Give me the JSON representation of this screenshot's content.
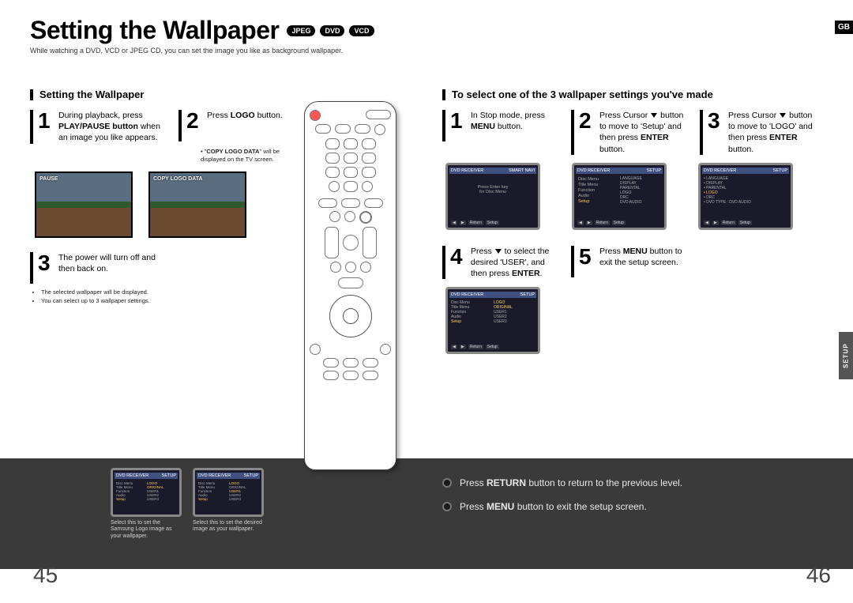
{
  "page": {
    "title": "Setting the Wallpaper",
    "subtitle": "While watching a DVD, VCD or JPEG CD, you can set the image you like as background wallpaper.",
    "badges": [
      "JPEG",
      "DVD",
      "VCD"
    ],
    "lang": "GB",
    "side_tab": "SETUP",
    "page_left": "45",
    "page_right": "46"
  },
  "left": {
    "heading": "Setting the Wallpaper",
    "step1_pre": "During playback, press ",
    "step1_bold": "PLAY/PAUSE button",
    "step1_post": " when an image you like appears.",
    "step2_pre": "Press ",
    "step2_bold": "LOGO",
    "step2_post": " button.",
    "note2_pre": "\"",
    "note2_bold": "COPY LOGO DATA",
    "note2_post": "\" will be displayed on the TV screen.",
    "photo1_overlay": "PAUSE",
    "photo2_overlay": "COPY LOGO DATA",
    "step3": "The power will turn off and then back on.",
    "note3a": "The selected wallpaper will be displayed.",
    "note3b": "You can select up to 3 wallpaper settings."
  },
  "right": {
    "heading": "To select one of the 3 wallpaper settings you've made",
    "step1_pre": "In Stop mode, press ",
    "step1_bold": "MENU",
    "step1_post": " button.",
    "step2_pre": "Press Cursor ",
    "step2_mid": " button to move to 'Setup' and then press ",
    "step2_bold": "ENTER",
    "step2_post": " button.",
    "step3_pre": "Press Cursor ",
    "step3_mid": " button to move to 'LOGO' and then press ",
    "step3_bold": "ENTER",
    "step3_post": " button.",
    "step4_pre": "Press ",
    "step4_mid": " to select the desired 'USER', and then press ",
    "step4_bold": "ENTER",
    "step4_post": ".",
    "step5_pre": "Press ",
    "step5_bold": "MENU",
    "step5_post": " button to exit the setup screen.",
    "screens": {
      "s1_title": "DVD RECEIVER",
      "s1_right": "SMART NAVI",
      "s1_line1": "Press Enter key",
      "s1_line2": "for Disc Menu",
      "s2_items": [
        "Disc Menu",
        "Title Menu",
        "Function",
        "Audio",
        "Setup"
      ],
      "s2_right": [
        "LANGUAGE",
        "DISPLAY",
        "PARENTAL",
        "LOGO",
        "DRC",
        "DVD AUDIO"
      ],
      "s3_items": [
        "LANGUAGE",
        "DISPLAY",
        "PARENTAL",
        "LOGO",
        "DRC",
        "DVD TYPE : DVD AUDIO"
      ],
      "s4_left": [
        "Disc Menu",
        "Title Menu",
        "Function",
        "Audio",
        "Setup"
      ],
      "s4_right_header": "LOGO",
      "s4_right": [
        "ORIGINAL",
        "USER1",
        "USER2",
        "USER3"
      ]
    }
  },
  "bottom": {
    "thumb1_caption": "Select this to set the Samsung Logo image as your wallpaper.",
    "thumb2_caption": "Select this to set the desired image as your wallpaper.",
    "tip1_pre": "Press ",
    "tip1_bold": "RETURN",
    "tip1_post": " button to return to the previous level.",
    "tip2_pre": "Press ",
    "tip2_bold": "MENU",
    "tip2_post": " button to exit the setup screen."
  }
}
